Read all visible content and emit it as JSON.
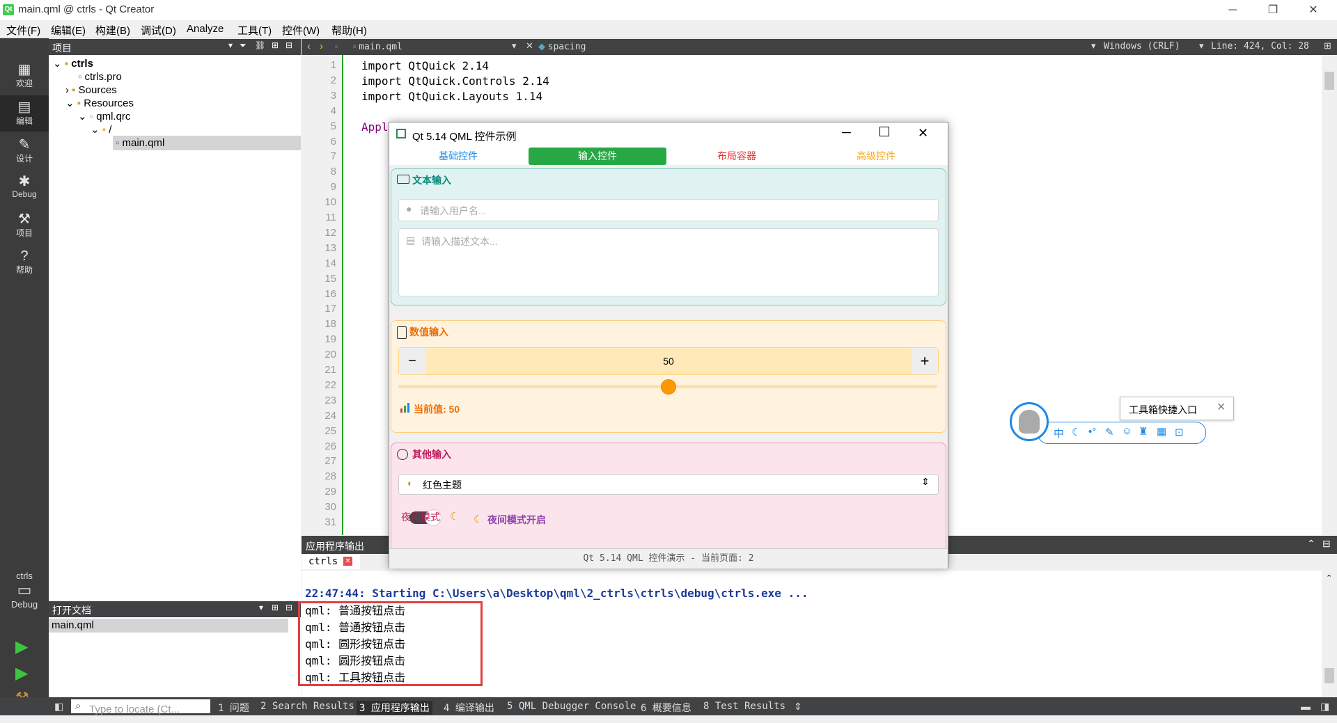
{
  "window": {
    "title": "main.qml @ ctrls - Qt Creator",
    "minimize": "─",
    "maximize": "❐",
    "close": "✕"
  },
  "menu": [
    "文件(F)",
    "编辑(E)",
    "构建(B)",
    "调试(D)",
    "Analyze",
    "工具(T)",
    "控件(W)",
    "帮助(H)"
  ],
  "modes": [
    {
      "label": "欢迎",
      "icon": "grid-icon"
    },
    {
      "label": "编辑",
      "icon": "edit-icon"
    },
    {
      "label": "设计",
      "icon": "pencil-icon"
    },
    {
      "label": "Debug",
      "icon": "bug-icon"
    },
    {
      "label": "项目",
      "icon": "wrench-icon"
    },
    {
      "label": "帮助",
      "icon": "help-icon"
    }
  ],
  "kit": {
    "name": "ctrls",
    "mode": "Debug"
  },
  "project_panel": {
    "title": "项目",
    "tree": [
      {
        "label": "ctrls",
        "bold": true
      },
      {
        "label": "ctrls.pro"
      },
      {
        "label": "Sources"
      },
      {
        "label": "Resources"
      },
      {
        "label": "qml.qrc"
      },
      {
        "label": "/"
      },
      {
        "label": "main.qml",
        "selected": true
      }
    ]
  },
  "open_docs": {
    "title": "打开文档",
    "items": [
      "main.qml"
    ]
  },
  "editor": {
    "file": "main.qml",
    "symbol": "spacing",
    "line_ending": "Windows (CRLF)",
    "position": "Line: 424, Col: 28",
    "code": [
      "import QtQuick 2.14",
      "import QtQuick.Controls 2.14",
      "import QtQuick.Layouts 1.14",
      "",
      "Appl"
    ],
    "line_numbers": [
      "1",
      "2",
      "3",
      "4",
      "5",
      "6",
      "7",
      "8",
      "9",
      "10",
      "11",
      "12",
      "13",
      "14",
      "15",
      "16",
      "17",
      "18",
      "19",
      "20",
      "21",
      "22",
      "23",
      "24",
      "25",
      "26",
      "27",
      "28",
      "29",
      "30",
      "31"
    ]
  },
  "output": {
    "title": "应用程序输出",
    "tab": "ctrls",
    "start_line": "22:47:44: Starting C:\\Users\\a\\Desktop\\qml\\2_ctrls\\ctrls\\debug\\ctrls.exe ...",
    "lines": [
      "qml: 普通按钮点击",
      "qml: 普通按钮点击",
      "qml: 圆形按钮点击",
      "qml: 圆形按钮点击",
      "qml: 工具按钮点击"
    ]
  },
  "statusbar": {
    "locate_placeholder": "Type to locate (Ct...",
    "tabs": [
      "1 问题",
      "2 Search Results",
      "3 应用程序输出",
      "4 编译输出",
      "5 QML Debugger Console",
      "6 概要信息",
      "8 Test Results"
    ]
  },
  "app": {
    "title": "Qt 5.14 QML 控件示例",
    "tabs": [
      {
        "label": "基础控件",
        "color": "#1e88e5"
      },
      {
        "label": "输入控件",
        "color": "#ffffff",
        "active": true
      },
      {
        "label": "布局容器",
        "color": "#e53935"
      },
      {
        "label": "高级控件",
        "color": "#f9a825"
      }
    ],
    "text_section": {
      "title": "文本输入",
      "username_placeholder": "请输入用户名...",
      "desc_placeholder": "请输入描述文本..."
    },
    "number_section": {
      "title": "数值输入",
      "value": "50",
      "minus": "−",
      "plus": "+",
      "slider_fraction": 0.5,
      "current_value": "当前值: 50"
    },
    "other_section": {
      "title": "其他输入",
      "theme": "红色主题",
      "night_label": "夜间模式",
      "night_status": "夜间模式开启"
    },
    "status": "Qt 5.14 QML 控件演示 - 当前页面: 2"
  },
  "toolbox": {
    "tooltip": "工具箱快捷入口",
    "icons": [
      "中",
      "moon-icon",
      "dots-icon",
      "wrench-icon",
      "smile-icon",
      "shirt-icon",
      "grid-icon",
      "lock-icon"
    ]
  }
}
